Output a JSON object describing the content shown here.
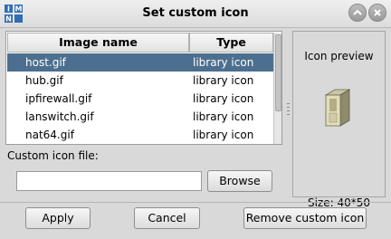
{
  "window": {
    "title": "Set custom icon",
    "app_icon_letters": [
      "I",
      "M",
      "N"
    ]
  },
  "table": {
    "columns": [
      "Image name",
      "Type"
    ],
    "rows": [
      {
        "name": "host.gif",
        "type": "library icon",
        "selected": true
      },
      {
        "name": "hub.gif",
        "type": "library icon",
        "selected": false
      },
      {
        "name": "ipfirewall.gif",
        "type": "library icon",
        "selected": false
      },
      {
        "name": "lanswitch.gif",
        "type": "library icon",
        "selected": false
      },
      {
        "name": "nat64.gif",
        "type": "library icon",
        "selected": false
      }
    ]
  },
  "custom_file": {
    "label": "Custom icon file:",
    "value": "",
    "browse_label": "Browse"
  },
  "preview": {
    "title": "Icon preview",
    "size_text": "Size: 40*50",
    "icon": "server-host-icon"
  },
  "buttons": {
    "apply": "Apply",
    "cancel": "Cancel",
    "remove": "Remove custom icon"
  },
  "colors": {
    "selection": "#4d6f8f",
    "app_icon_blue": "#2f6db5"
  }
}
